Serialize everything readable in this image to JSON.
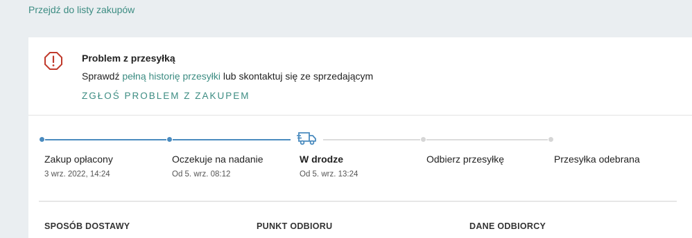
{
  "nav": {
    "back_link": "Przejdź do listy zakupów"
  },
  "alert": {
    "title": "Problem z przesyłką",
    "body_prefix": "Sprawdź ",
    "history_link": "pełną historię przesyłki",
    "body_suffix": " lub skontaktuj się ze sprzedającym",
    "report_link": "ZGŁOŚ PROBLEM Z ZAKUPEM",
    "icon": "alert-octagon-icon",
    "icon_color": "#c0392b"
  },
  "tracking": {
    "progress_fraction": 0.5,
    "steps": [
      {
        "label": "Zakup opłacony",
        "date": "3 wrz. 2022, 14:24",
        "state": "done"
      },
      {
        "label": "Oczekuje na nadanie",
        "date": "Od 5. wrz. 08:12",
        "state": "done"
      },
      {
        "label": "W drodze",
        "date": "Od 5. wrz. 13:24",
        "state": "current",
        "icon": "truck-icon"
      },
      {
        "label": "Odbierz przesyłkę",
        "date": "",
        "state": "todo"
      },
      {
        "label": "Przesyłka odebrana",
        "date": "",
        "state": "todo"
      }
    ]
  },
  "details": {
    "columns": [
      "SPOSÓB DOSTAWY",
      "PUNKT ODBIORU",
      "DANE ODBIORCY"
    ]
  },
  "colors": {
    "accent_green": "#3c8c82",
    "progress_blue": "#4a8bbf",
    "background": "#eaeef1"
  }
}
